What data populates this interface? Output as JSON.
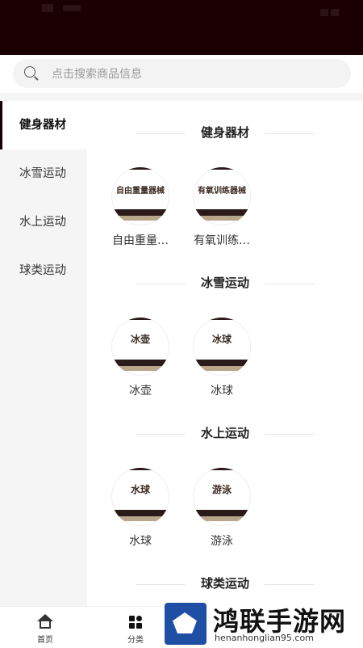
{
  "search": {
    "placeholder": "点击搜索商品信息"
  },
  "sidebar": {
    "items": [
      {
        "label": "健身器材",
        "active": true
      },
      {
        "label": "冰雪运动",
        "active": false
      },
      {
        "label": "水上运动",
        "active": false
      },
      {
        "label": "球类运动",
        "active": false
      }
    ]
  },
  "sections": [
    {
      "title": "健身器材",
      "items": [
        {
          "name": "自由重量…",
          "thumb_text": "自由重量器械"
        },
        {
          "name": "有氧训练…",
          "thumb_text": "有氧训练器械"
        }
      ]
    },
    {
      "title": "冰雪运动",
      "items": [
        {
          "name": "冰壶",
          "thumb_text": "冰壶"
        },
        {
          "name": "冰球",
          "thumb_text": "冰球"
        }
      ]
    },
    {
      "title": "水上运动",
      "items": [
        {
          "name": "水球",
          "thumb_text": "水球"
        },
        {
          "name": "游泳",
          "thumb_text": "游泳"
        }
      ]
    },
    {
      "title": "球类运动",
      "items": []
    }
  ],
  "tabbar": {
    "tabs": [
      {
        "label": "首页",
        "icon": "home-icon"
      },
      {
        "label": "分类",
        "icon": "category-icon"
      }
    ]
  },
  "watermark": {
    "title": "鸿联手游网",
    "url": "henanhonglian95.com"
  },
  "colors": {
    "statusbar": "#1a0002",
    "accent": "#1a0002",
    "sidebar_bg": "#f5f5f5"
  }
}
